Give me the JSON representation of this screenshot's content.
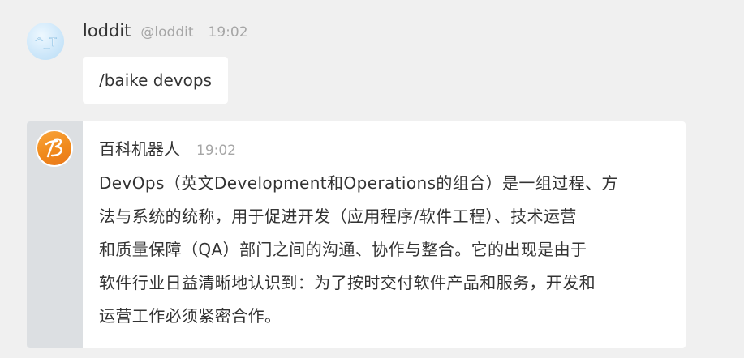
{
  "messages": [
    {
      "sender_name": "loddit",
      "sender_handle": "@loddit",
      "time": "19:02",
      "text": "/baike devops",
      "avatar_icon": "kaomoji-avatar-icon"
    },
    {
      "sender_name": "百科机器人",
      "time": "19:02",
      "avatar_icon": "baike-logo-icon",
      "text_lines": [
        "DevOps（英文Development和Operations的组合）是一组过程、方",
        "法与系统的统称，用于促进开发（应用程序/软件工程）、技术运营",
        "和质量保障（QA）部门之间的沟通、协作与整合。它的出现是由于",
        "软件行业日益清晰地认识到：为了按时交付软件产品和服务，开发和",
        "运营工作必须紧密合作。"
      ]
    }
  ],
  "colors": {
    "background": "#f0f0f0",
    "bubble": "#ffffff",
    "bot_sidebar": "#dcdfe2",
    "meta_text": "#a6a6a6",
    "bot_logo": "#f08a1c"
  }
}
